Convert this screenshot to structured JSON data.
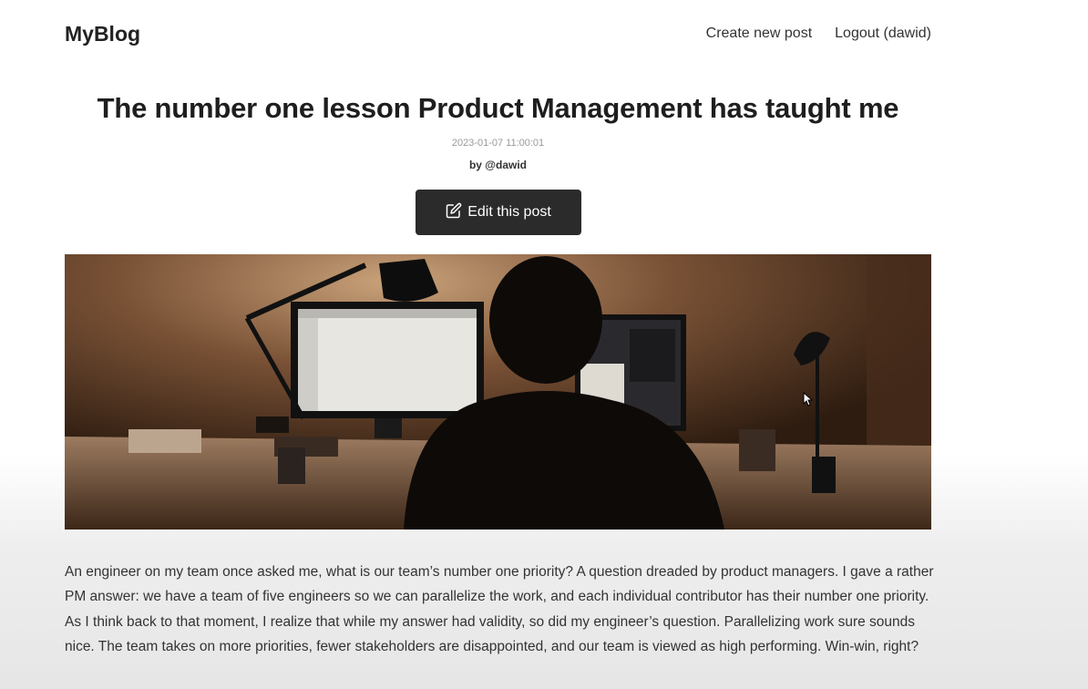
{
  "header": {
    "brand": "MyBlog",
    "nav": {
      "create": "Create new post",
      "logout": "Logout (dawid)"
    }
  },
  "post": {
    "title": "The number one lesson Product Management has taught me",
    "date": "2023-01-07 11:00:01",
    "author": "by @dawid",
    "edit_label": "Edit this post",
    "body": "An engineer on my team once asked me, what is our team’s number one priority? A question dreaded by product managers. I gave a rather PM answer: we have a team of five engineers so we can parallelize the work, and each individual contributor has their number one priority. As I think back to that moment, I realize that while my answer had validity, so did my engineer’s question. Parallelizing work sure sounds nice. The team takes on more priorities, fewer stakeholders are disappointed, and our team is viewed as high performing. Win-win, right?"
  },
  "icons": {
    "edit": "pencil-square-icon",
    "cursor": "mouse-pointer-icon"
  },
  "colors": {
    "button_bg": "#2b2b2b",
    "text": "#222222"
  }
}
